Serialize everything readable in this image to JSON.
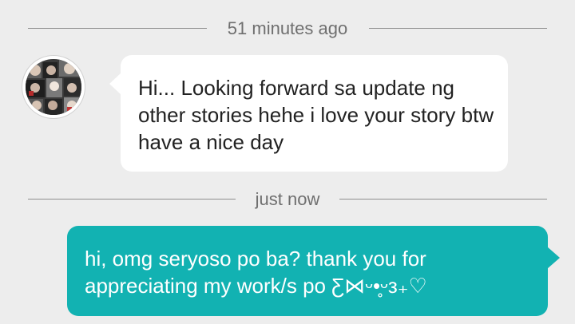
{
  "theme": {
    "background": "#ededed",
    "incoming_bubble": "#ffffff",
    "outgoing_bubble": "#12b2b2",
    "timestamp_color": "#6f6f6f"
  },
  "messages": [
    {
      "timestamp": "51 minutes ago",
      "direction": "incoming",
      "avatar": "user-avatar",
      "text": "Hi... Looking forward sa update ng other stories hehe i love your story btw have a nice day"
    },
    {
      "timestamp": "just now",
      "direction": "outgoing",
      "text": "hi, omg seryoso po ba? thank you for appreciating my work/s po Ƹ⋈ᵕ•̥ᵕз₊♡"
    }
  ]
}
